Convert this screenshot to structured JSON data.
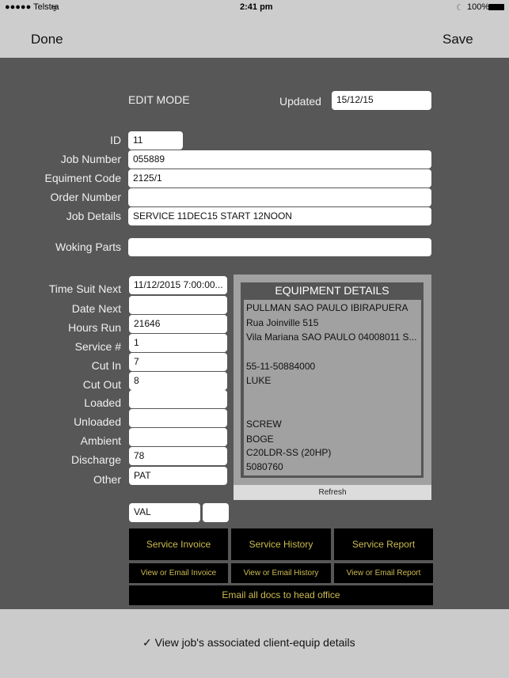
{
  "status": {
    "carrier": "●●●●● Telstra",
    "time": "2:41 pm",
    "battery": "100%"
  },
  "nav": {
    "done": "Done",
    "save": "Save"
  },
  "header": {
    "mode": "EDIT MODE",
    "updated_label": "Updated",
    "updated_value": "15/12/15"
  },
  "fields": [
    {
      "label": "ID",
      "value": "11"
    },
    {
      "label": "Job Number",
      "value": "055889"
    },
    {
      "label": "Equiment Code",
      "value": "2125/1"
    },
    {
      "label": "Order Number",
      "value": ""
    },
    {
      "label": "Job Details",
      "value": "SERVICE  11DEC15  START 12NOON"
    },
    {
      "label": "Woking Parts",
      "value": ""
    }
  ],
  "readings": [
    {
      "label": "Time Suit Next",
      "value": "11/12/2015 7:00:00..."
    },
    {
      "label": "Date Next",
      "value": ""
    },
    {
      "label": "Hours Run",
      "value": "21646"
    },
    {
      "label": "Service #",
      "value": "1"
    },
    {
      "label": "Cut In",
      "value": "7"
    },
    {
      "label": "Cut Out",
      "value": "8"
    },
    {
      "label": "Loaded",
      "value": ""
    },
    {
      "label": "Unloaded",
      "value": ""
    },
    {
      "label": "Ambient",
      "value": ""
    },
    {
      "label": "Discharge",
      "value": "78"
    },
    {
      "label": "Other",
      "value": "PAT"
    }
  ],
  "equipment": {
    "title": "EQUIPMENT DETAILS",
    "lines": [
      "PULLMAN SAO PAULO IBIRAPUERA",
      "Rua Joinville 515",
      "Vila Mariana SAO PAULO 04008011 S...",
      "55-11-50884000",
      "LUKE",
      "SCREW",
      "BOGE",
      "C20LDR-SS (20HP)",
      "5080760"
    ],
    "refresh": "Refresh"
  },
  "sign": {
    "value": "VAL",
    "extra": ""
  },
  "buttons": {
    "invoice": "Service Invoice",
    "history": "Service History",
    "report": "Service Report",
    "view_invoice": "View or Email Invoice",
    "view_history": "View or Email History",
    "view_report": "View or Email Report",
    "email_all": "Email all docs to head office"
  },
  "footer": {
    "check": "✓",
    "label": "View job's associated client-equip details"
  },
  "colors": {
    "background": "#575757",
    "button_text": "#cdbb4f",
    "bar": "#cdcdcd"
  }
}
